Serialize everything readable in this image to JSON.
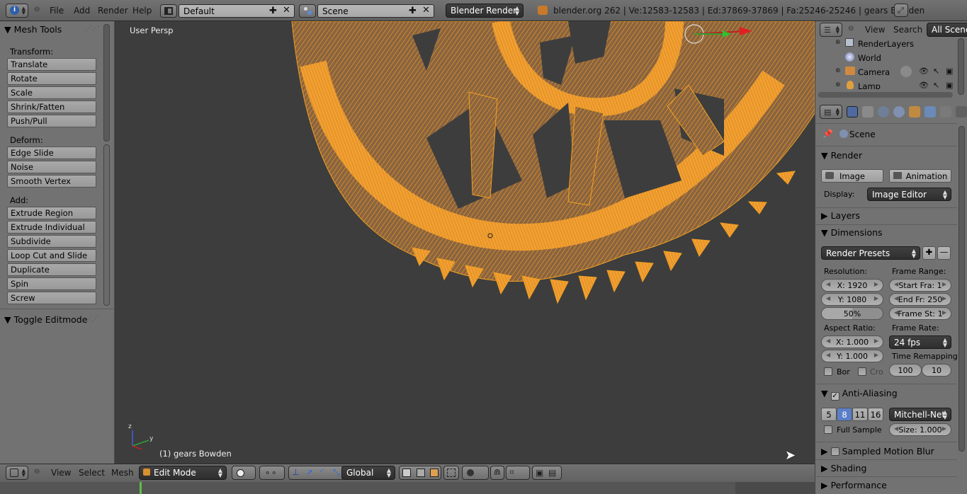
{
  "header": {
    "menus": [
      "File",
      "Add",
      "Render",
      "Help"
    ],
    "screen_layout": "Default",
    "scene": "Scene",
    "render_engine": "Blender Render",
    "stats": "blender.org 262 | Ve:12583-12583 | Ed:37869-37869 | Fa:25246-25246 | gears Bowden"
  },
  "toolshelf": {
    "title": "Mesh Tools",
    "transform_label": "Transform:",
    "transform": [
      "Translate",
      "Rotate",
      "Scale",
      "Shrink/Fatten",
      "Push/Pull"
    ],
    "deform_label": "Deform:",
    "deform": [
      "Edge Slide",
      "Noise",
      "Smooth Vertex"
    ],
    "add_label": "Add:",
    "add": [
      "Extrude Region",
      "Extrude Individual",
      "Subdivide",
      "Loop Cut and Slide",
      "Duplicate",
      "Spin",
      "Screw"
    ],
    "toggle_editmode": "Toggle Editmode"
  },
  "viewport": {
    "view_label": "User Persp",
    "object_label": "(1) gears Bowden",
    "mesh_color": "#f5a020"
  },
  "bottom_header": {
    "menus": [
      "View",
      "Select",
      "Mesh"
    ],
    "mode": "Edit Mode",
    "orientation": "Global"
  },
  "outliner": {
    "menus": [
      "View",
      "Search"
    ],
    "filter": "All Scenes",
    "items": [
      "RenderLayers",
      "World",
      "Camera",
      "Lamp"
    ]
  },
  "properties": {
    "context": "Scene",
    "render_panel": "Render",
    "image_button": "Image",
    "animation_button": "Animation",
    "display_label": "Display:",
    "display_value": "Image Editor",
    "layers_panel": "Layers",
    "dimensions_panel": "Dimensions",
    "render_presets": "Render Presets",
    "resolution_label": "Resolution:",
    "res_x": "X: 1920",
    "res_y": "Y: 1080",
    "res_percent": "50%",
    "frame_range_label": "Frame Range:",
    "start_frame": "Start Fra: 1",
    "end_frame": "End Fr: 250",
    "frame_step": "Frame St: 1",
    "aspect_ratio_label": "Aspect Ratio:",
    "aspect_x": "X: 1.000",
    "aspect_y": "Y: 1.000",
    "frame_rate_label": "Frame Rate:",
    "frame_rate": "24 fps",
    "time_remapping_label": "Time Remapping",
    "remap_old": "100",
    "remap_new": "10",
    "border_label": "Bor",
    "crop_label": "Cro",
    "antialiasing_panel": "Anti-Aliasing",
    "aa_samples": [
      "5",
      "8",
      "11",
      "16"
    ],
    "aa_selected": "8",
    "aa_filter": "Mitchell-Net",
    "full_sample": "Full Sample",
    "filter_size": "Size: 1.000",
    "motion_blur_panel": "Sampled Motion Blur",
    "shading_panel": "Shading",
    "performance_panel": "Performance"
  }
}
